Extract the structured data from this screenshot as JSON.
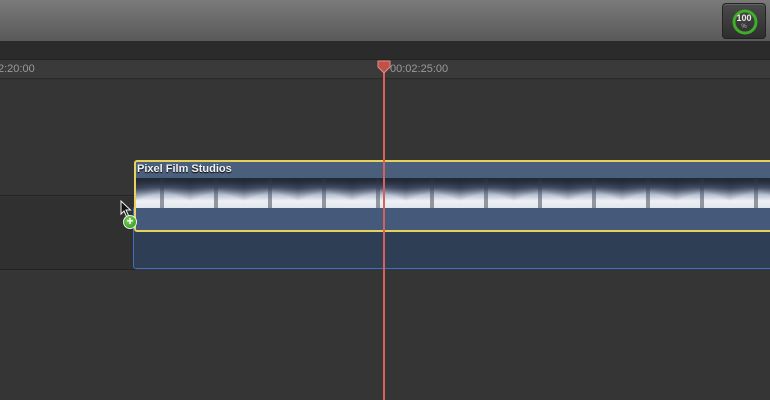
{
  "toolbar": {
    "progress": {
      "value": 100,
      "text": "100",
      "unit": "%",
      "color": "#3fae2a"
    }
  },
  "ruler": {
    "timecodes": [
      "2:20:00",
      "00:02:25:00"
    ]
  },
  "timeline": {
    "connected_clip": {
      "title": "Pixel Film Studios"
    }
  },
  "icons": {
    "pointer": "arrow-pointer-icon",
    "add": "green-plus-badge-icon",
    "playhead": "playhead-marker-icon"
  },
  "colors": {
    "playhead": "#d8605a",
    "selection_outline": "#e6d25a",
    "primary_outline": "#3f6fc6"
  }
}
